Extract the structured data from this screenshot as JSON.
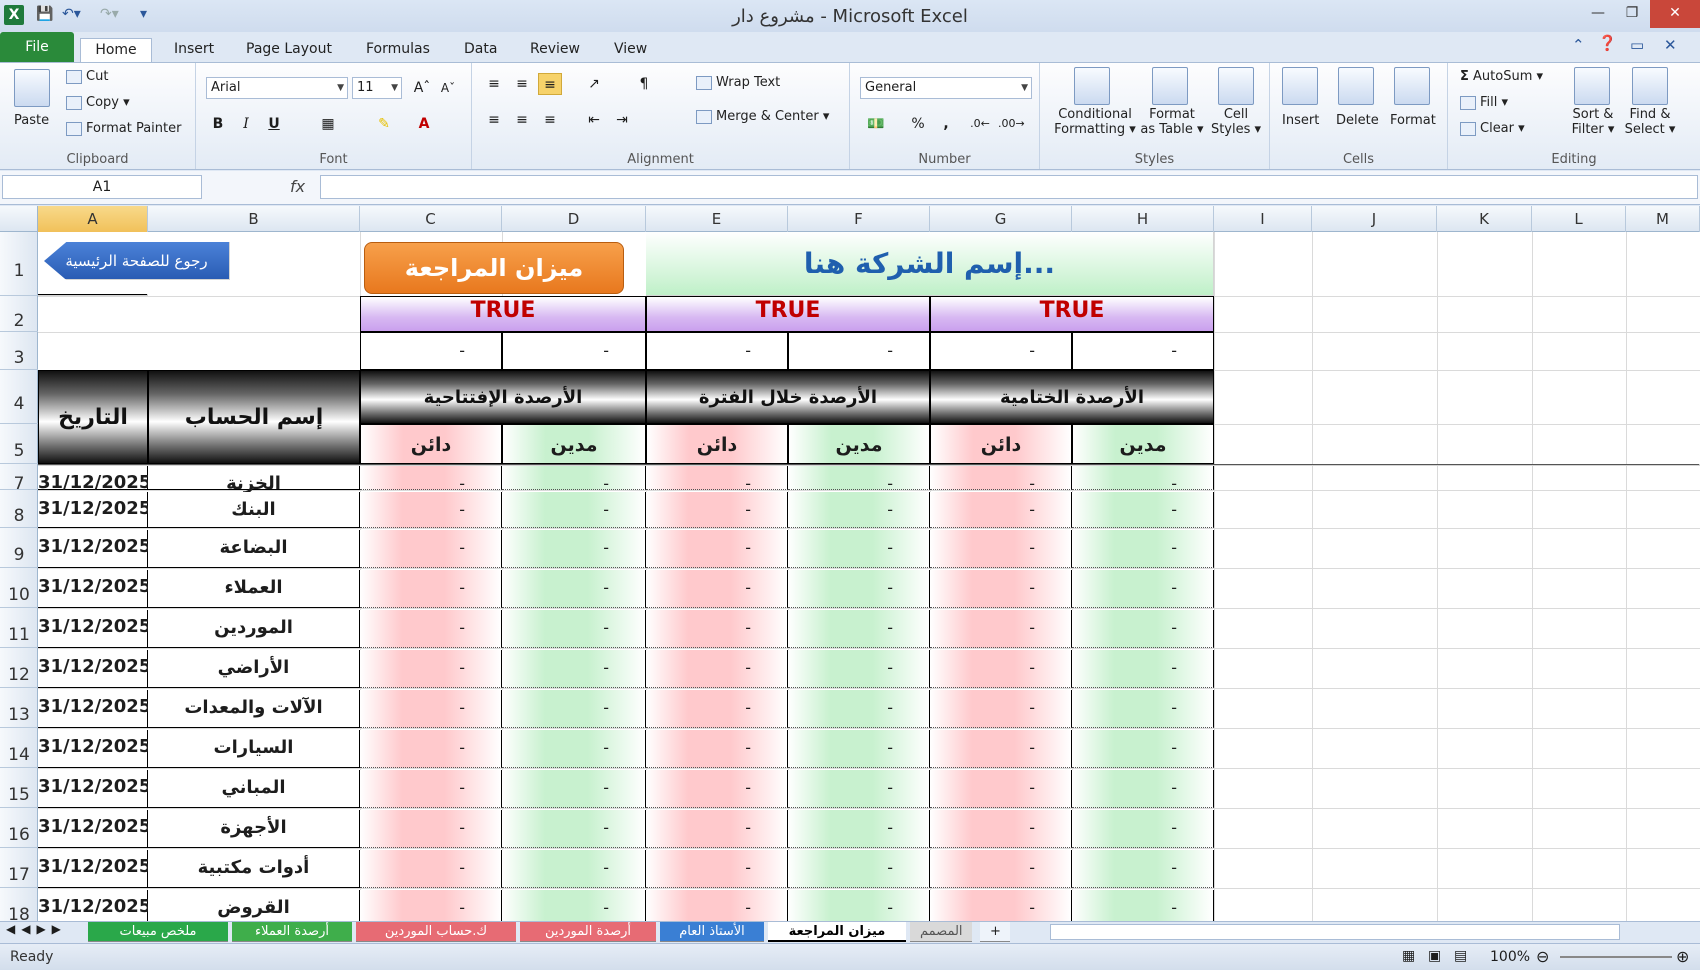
{
  "window": {
    "title": "مشروع دار  -  Microsoft Excel"
  },
  "ribbon_tabs": [
    "File",
    "Home",
    "Insert",
    "Page Layout",
    "Formulas",
    "Data",
    "Review",
    "View"
  ],
  "clipboard": {
    "paste": "Paste",
    "cut": "Cut",
    "copy": "Copy",
    "format_painter": "Format Painter",
    "label": "Clipboard"
  },
  "font": {
    "name": "Arial",
    "size": "11",
    "label": "Font",
    "bold": "B",
    "italic": "I",
    "underline": "U"
  },
  "alignment": {
    "wrap": "Wrap Text",
    "merge": "Merge & Center",
    "label": "Alignment"
  },
  "number": {
    "format": "General",
    "percent": "%",
    "comma": ",",
    "label": "Number"
  },
  "styles": {
    "conditional": "Conditional",
    "conditional2": "Formatting",
    "format_table": "Format",
    "format_table2": "as Table",
    "cell_styles": "Cell",
    "cell_styles2": "Styles",
    "label": "Styles"
  },
  "cells": {
    "insert": "Insert",
    "delete": "Delete",
    "format": "Format",
    "label": "Cells"
  },
  "editing": {
    "autosum": "AutoSum",
    "fill": "Fill",
    "clear": "Clear",
    "sort": "Sort &",
    "sort2": "Filter",
    "find": "Find &",
    "find2": "Select",
    "label": "Editing"
  },
  "formula_bar": {
    "namebox": "A1",
    "fx": "fx"
  },
  "columns": [
    "A",
    "B",
    "C",
    "D",
    "E",
    "F",
    "G",
    "H",
    "I",
    "J",
    "K",
    "L",
    "M"
  ],
  "rows": [
    "1",
    "2",
    "3",
    "4",
    "5",
    "7",
    "8",
    "9",
    "10",
    "11",
    "12",
    "13",
    "14",
    "15",
    "16",
    "17",
    "18"
  ],
  "sheet": {
    "back_button": "رجوع للصفحة الرئيسية",
    "title_button": "ميزان المراجعة",
    "company": "إسم الشركة هنا...",
    "true_flags": [
      "TRUE",
      "TRUE",
      "TRUE"
    ],
    "dash": "-",
    "hdr_date": "التاريخ",
    "hdr_account": "إسم الحساب",
    "hdr_opening": "الأرصدة الإفتتاحية",
    "hdr_period": "الأرصدة خلال الفترة",
    "hdr_closing": "الأرصدة الختامية",
    "credit": "دائن",
    "debit": "مدين",
    "entries": [
      {
        "date": "31/12/2025",
        "account": "الخزنة"
      },
      {
        "date": "31/12/2025",
        "account": "البنك"
      },
      {
        "date": "31/12/2025",
        "account": "البضاعة"
      },
      {
        "date": "31/12/2025",
        "account": "العملاء"
      },
      {
        "date": "31/12/2025",
        "account": "الموردين"
      },
      {
        "date": "31/12/2025",
        "account": "الأراضي"
      },
      {
        "date": "31/12/2025",
        "account": "الآلات والمعدات"
      },
      {
        "date": "31/12/2025",
        "account": "السيارات"
      },
      {
        "date": "31/12/2025",
        "account": "المباني"
      },
      {
        "date": "31/12/2025",
        "account": "الأجهزة"
      },
      {
        "date": "31/12/2025",
        "account": "أدوات مكتبية"
      },
      {
        "date": "31/12/2025",
        "account": "القروض"
      }
    ]
  },
  "sheet_tabs": [
    "ملخص مبيعات",
    "أرصدة العملاء",
    "ك.حساب الموردين",
    "أرصدة الموردين",
    "الأستاذ العام",
    "ميزان المراجعة",
    "المصمم"
  ],
  "status": {
    "ready": "Ready",
    "zoom": "100%"
  },
  "colors": {
    "accent": "#2a8a3a",
    "title_button": "#e8781e",
    "back_button": "#2f66c1",
    "company_text": "#1f5fae",
    "true_text": "#c00000"
  }
}
